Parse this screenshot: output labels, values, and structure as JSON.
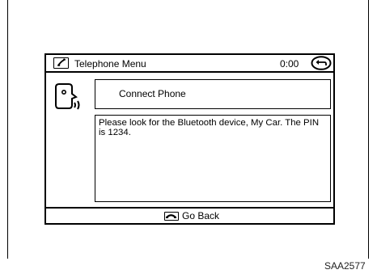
{
  "titlebar": {
    "title": "Telephone Menu",
    "clock": "0:00"
  },
  "main": {
    "connect_label": "Connect Phone",
    "message": "Please look for the Bluetooth device, My Car. The PIN is 1234."
  },
  "footer": {
    "back_label": "Go Back"
  },
  "figure_code": "SAA2577",
  "icons": {
    "title": "phone-handset-icon",
    "back": "return-arrow-icon",
    "voice": "voice-recognition-icon",
    "footer": "phone-hangup-icon"
  }
}
